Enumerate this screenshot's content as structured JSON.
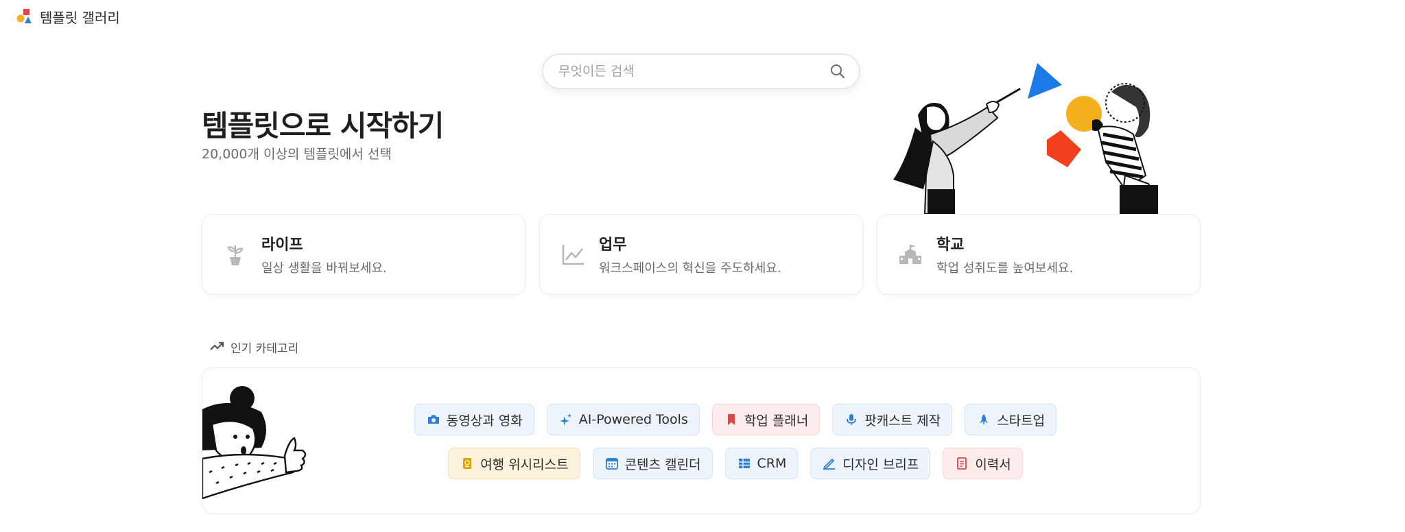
{
  "app": {
    "title": "템플릿 갤러리"
  },
  "search": {
    "placeholder": "무엇이든 검색"
  },
  "hero": {
    "title": "템플릿으로 시작하기",
    "subtitle": "20,000개 이상의 템플릿에서 선택"
  },
  "cards": [
    {
      "title": "라이프",
      "desc": "일상 생활을 바꿔보세요.",
      "icon": "plant-icon"
    },
    {
      "title": "업무",
      "desc": "워크스페이스의 혁신을 주도하세요.",
      "icon": "chart-line-icon"
    },
    {
      "title": "학교",
      "desc": "학업 성취도를 높여보세요.",
      "icon": "school-icon"
    }
  ],
  "popular": {
    "label": "인기 카테고리",
    "rows": [
      [
        {
          "label": "동영상과 영화",
          "icon": "camera-icon",
          "color": "#2f7fd3"
        },
        {
          "label": "AI-Powered Tools",
          "icon": "sparkle-icon",
          "color": "#2f7fd3"
        },
        {
          "label": "학업 플래너",
          "icon": "bookmark-icon",
          "color": "#e0464c"
        },
        {
          "label": "팟캐스트 제작",
          "icon": "microphone-icon",
          "color": "#2f7fd3"
        },
        {
          "label": "스타트업",
          "icon": "rocket-icon",
          "color": "#2f7fd3"
        }
      ],
      [
        {
          "label": "여행 위시리스트",
          "icon": "passport-icon",
          "color": "#e2a400"
        },
        {
          "label": "콘텐츠 캘린더",
          "icon": "calendar-icon",
          "color": "#2f7fd3"
        },
        {
          "label": "CRM",
          "icon": "grid-icon",
          "color": "#2f7fd3"
        },
        {
          "label": "디자인 브리프",
          "icon": "pen-icon",
          "color": "#2f7fd3"
        },
        {
          "label": "이력서",
          "icon": "document-icon",
          "color": "#e0464c"
        }
      ]
    ]
  },
  "colors": {
    "accent_blue": "#2f7fd3",
    "accent_red": "#e0464c",
    "accent_yellow": "#f5b01e",
    "shape_blue": "#1a7ae8",
    "shape_red": "#f2401f"
  }
}
